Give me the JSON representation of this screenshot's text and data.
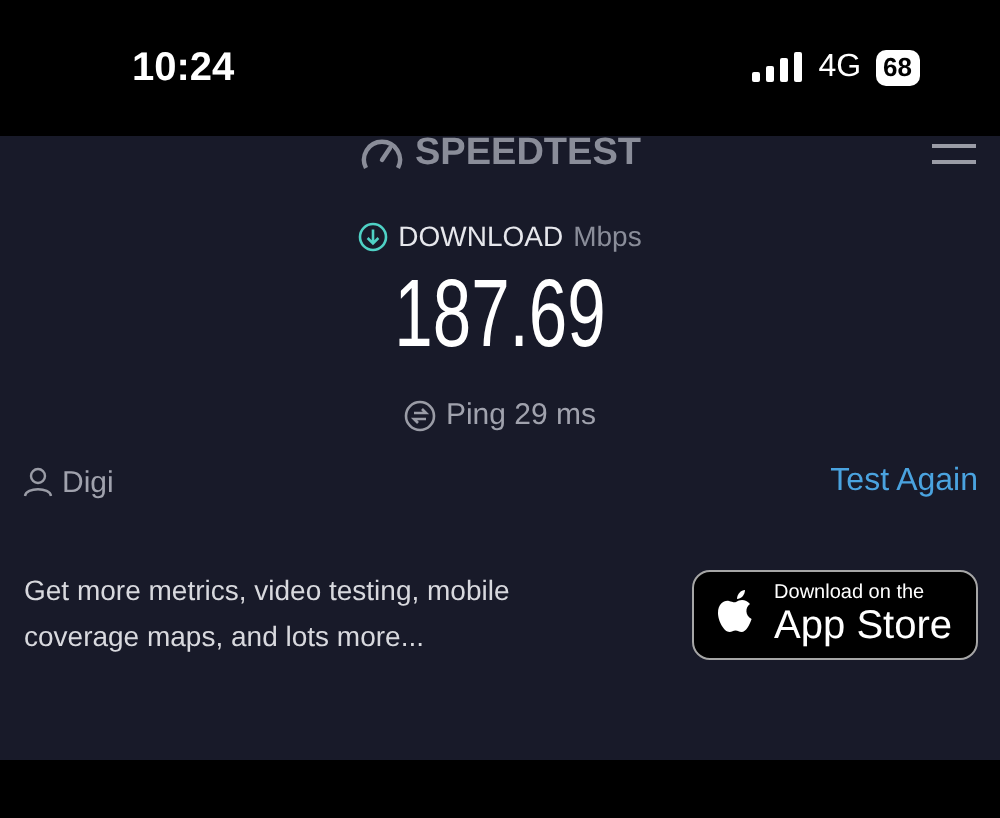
{
  "status_bar": {
    "time": "10:24",
    "network": "4G",
    "battery": "68"
  },
  "header": {
    "logo": "SPEEDTEST"
  },
  "result": {
    "label": "DOWNLOAD",
    "unit": "Mbps",
    "value": "187.69",
    "ping": "Ping 29 ms"
  },
  "provider": "Digi",
  "test_again": "Test Again",
  "promo": {
    "text": "Get more metrics, video testing, mobile coverage maps, and lots more...",
    "badge_small": "Download on the",
    "badge_large": "App Store"
  }
}
